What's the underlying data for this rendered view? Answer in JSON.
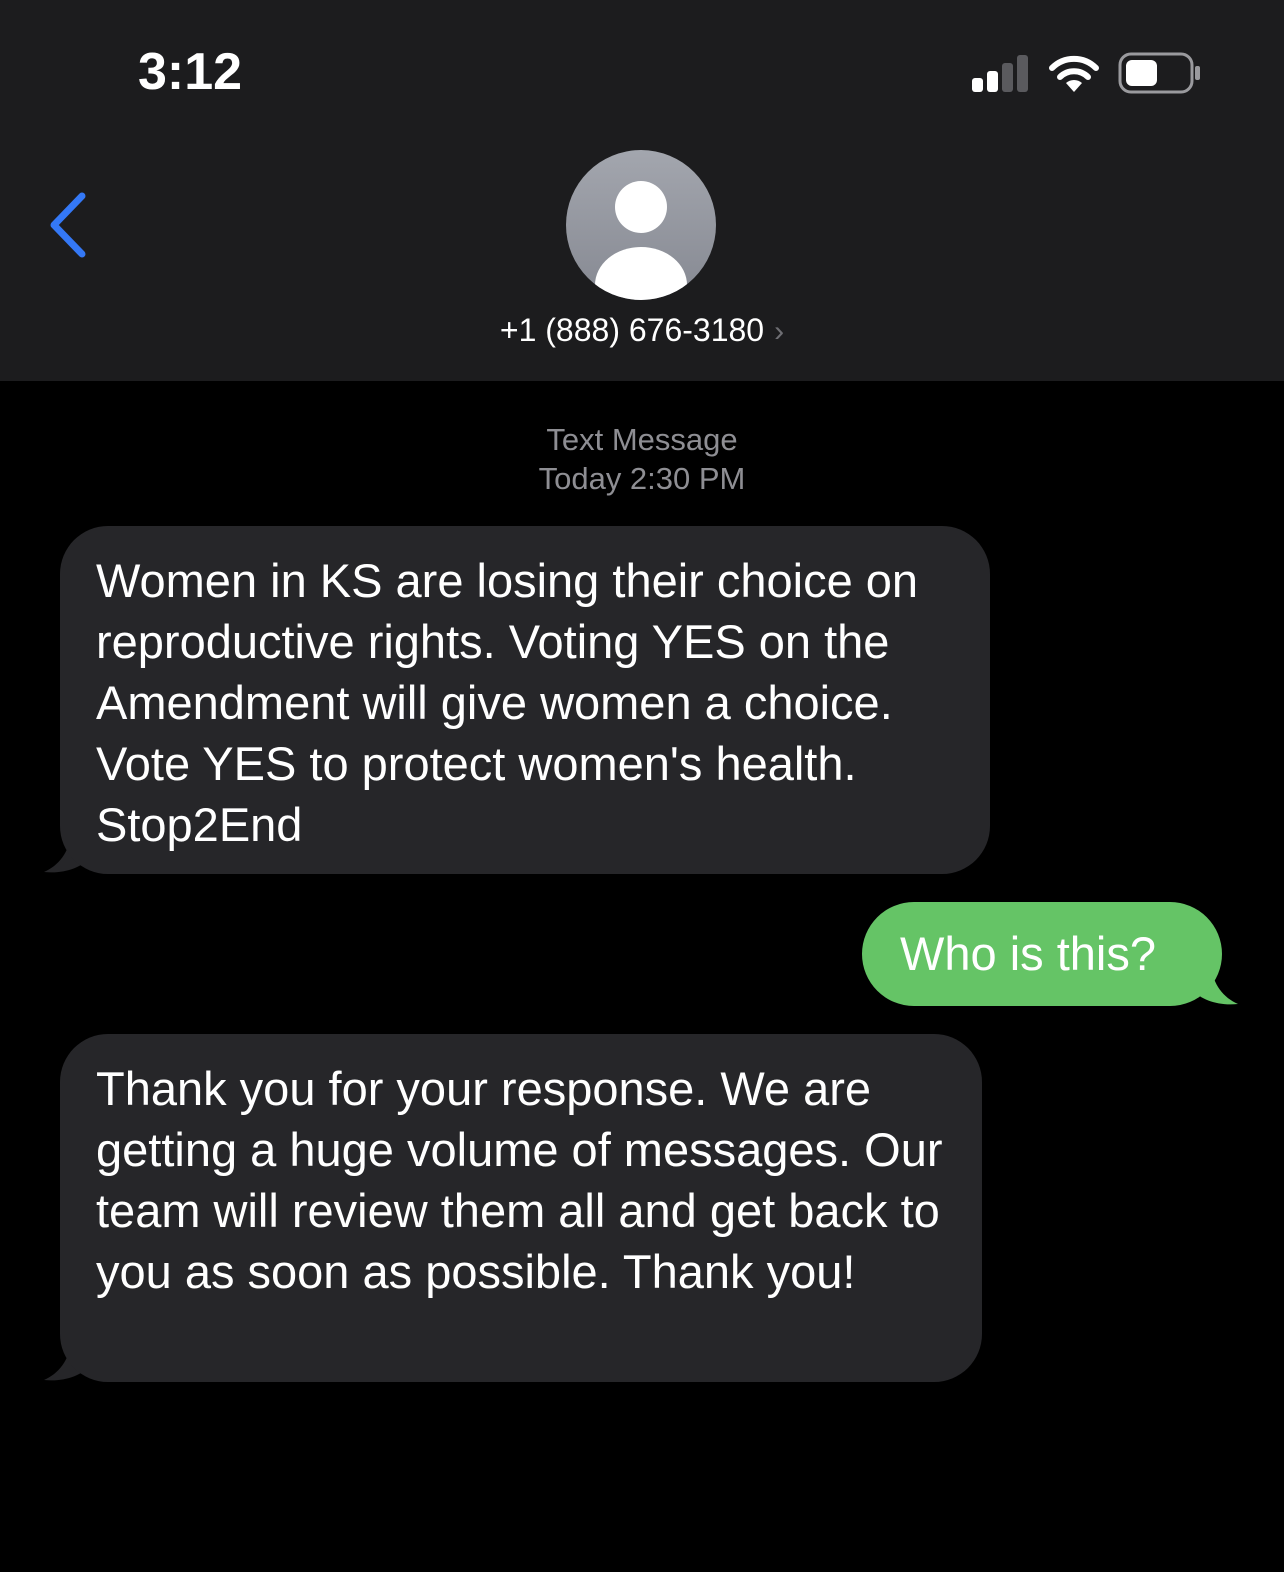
{
  "status_bar": {
    "time": "3:12"
  },
  "contact": {
    "phone": "+1 (888) 676-3180",
    "chevron": "›"
  },
  "thread_meta": {
    "type": "Text Message",
    "timestamp": "Today 2:30 PM"
  },
  "messages": [
    {
      "direction": "incoming",
      "text": "Women in KS are losing their choice on reproductive rights. Voting YES on the Amendment will give women a choice. Vote YES to protect women's health. Stop2End"
    },
    {
      "direction": "outgoing",
      "text": "Who is this?"
    },
    {
      "direction": "incoming",
      "text": "Thank you for your response. We are getting a huge volume of messages. Our team will review them all and get back to you as soon as possible. Thank you!"
    }
  ],
  "colors": {
    "header_bg": "#1c1c1e",
    "background": "#000000",
    "incoming_bubble": "#262629",
    "outgoing_bubble": "#65c466",
    "accent_blue": "#3478f6",
    "meta_text": "#8e8e93"
  },
  "icons": {
    "back": "chevron-left-icon",
    "signal": "cellular-signal-icon",
    "wifi": "wifi-icon",
    "battery": "battery-icon",
    "avatar": "person-avatar-icon"
  }
}
